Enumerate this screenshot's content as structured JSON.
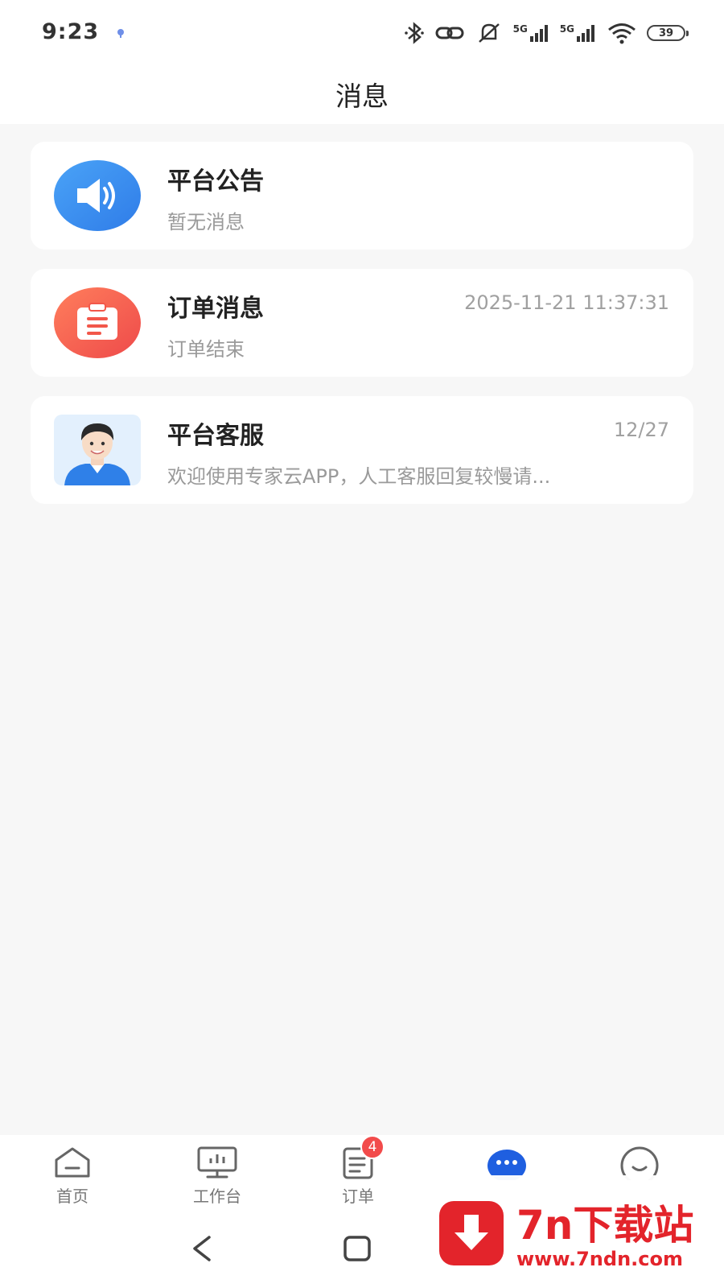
{
  "status_bar": {
    "time": "9:23",
    "battery": "39",
    "network_label_1": "5G",
    "network_label_2": "5G"
  },
  "header": {
    "title": "消息"
  },
  "messages": [
    {
      "icon": "megaphone-icon",
      "title": "平台公告",
      "subtitle": "暂无消息",
      "time": ""
    },
    {
      "icon": "clipboard-icon",
      "title": "订单消息",
      "subtitle": "订单结束",
      "time": "2025-11-21 11:37:31"
    },
    {
      "icon": "agent-avatar",
      "title": "平台客服",
      "subtitle": "欢迎使用专家云APP，人工客服回复较慢请...",
      "time": "12/27"
    }
  ],
  "tabbar": {
    "items": [
      {
        "label": "首页",
        "icon": "home-icon"
      },
      {
        "label": "工作台",
        "icon": "monitor-icon"
      },
      {
        "label": "订单",
        "icon": "order-icon",
        "badge": "4"
      },
      {
        "label": "",
        "icon": "message-icon"
      },
      {
        "label": "",
        "icon": "profile-icon"
      }
    ]
  },
  "watermark": {
    "title": "7n下载站",
    "url": "www.7ndn.com"
  },
  "colors": {
    "accent_blue": "#1f5fe0",
    "announce_blue": "#3a8ef0",
    "order_red": "#f2574a",
    "badge_red": "#f24b4b",
    "background": "#f7f7f7"
  }
}
